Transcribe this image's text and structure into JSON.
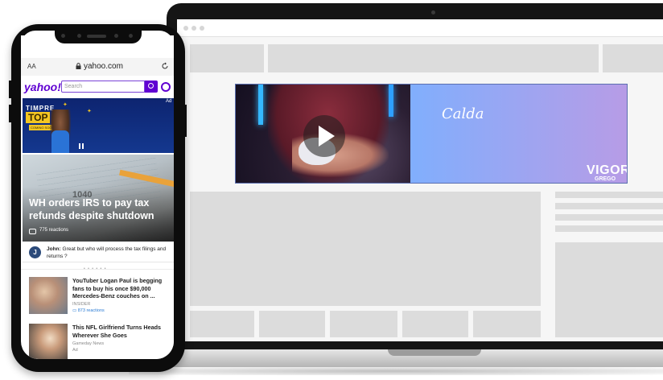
{
  "phone": {
    "url_bar": {
      "text_size_label": "AA",
      "url": "yahoo.com"
    },
    "yahoo_header": {
      "logo": "yahoo!",
      "search_placeholder": "Search"
    },
    "ad_banner": {
      "ad_label": "Ad",
      "brand_line1": "TIMPRE",
      "brand_line2": "TOP",
      "cta": "COMING SOON"
    },
    "hero_story": {
      "title": "WH orders IRS to pay tax refunds despite shutdown",
      "reactions": "775 reactions",
      "image_text": "1040"
    },
    "comment": {
      "avatar_letter": "J",
      "author": "John:",
      "text": "Great but who will process the tax filings and returns ?"
    },
    "pager": "• • • • • •",
    "stories": [
      {
        "title": "YouTuber Logan Paul is begging fans to buy his once $90,000 Mercedes-Benz couches on ...",
        "source": "INSIDER",
        "reactions": "873 reactions"
      },
      {
        "title": "This NFL Girlfriend Turns Heads Wherever She Goes",
        "source": "Gameday News",
        "ad_label": "Ad"
      }
    ]
  },
  "laptop": {
    "video_ad": {
      "script_text": "Calda",
      "brand": "VIGOR",
      "sub_brand": "GREGO"
    }
  },
  "colors": {
    "yahoo_purple": "#6001d2",
    "placeholder_gray": "#dcdcdc",
    "link_blue": "#2a7bd4"
  },
  "icons": [
    "lock-icon",
    "reload-icon",
    "search-icon",
    "mail-icon",
    "pause-icon",
    "play-icon",
    "comment-icon"
  ]
}
